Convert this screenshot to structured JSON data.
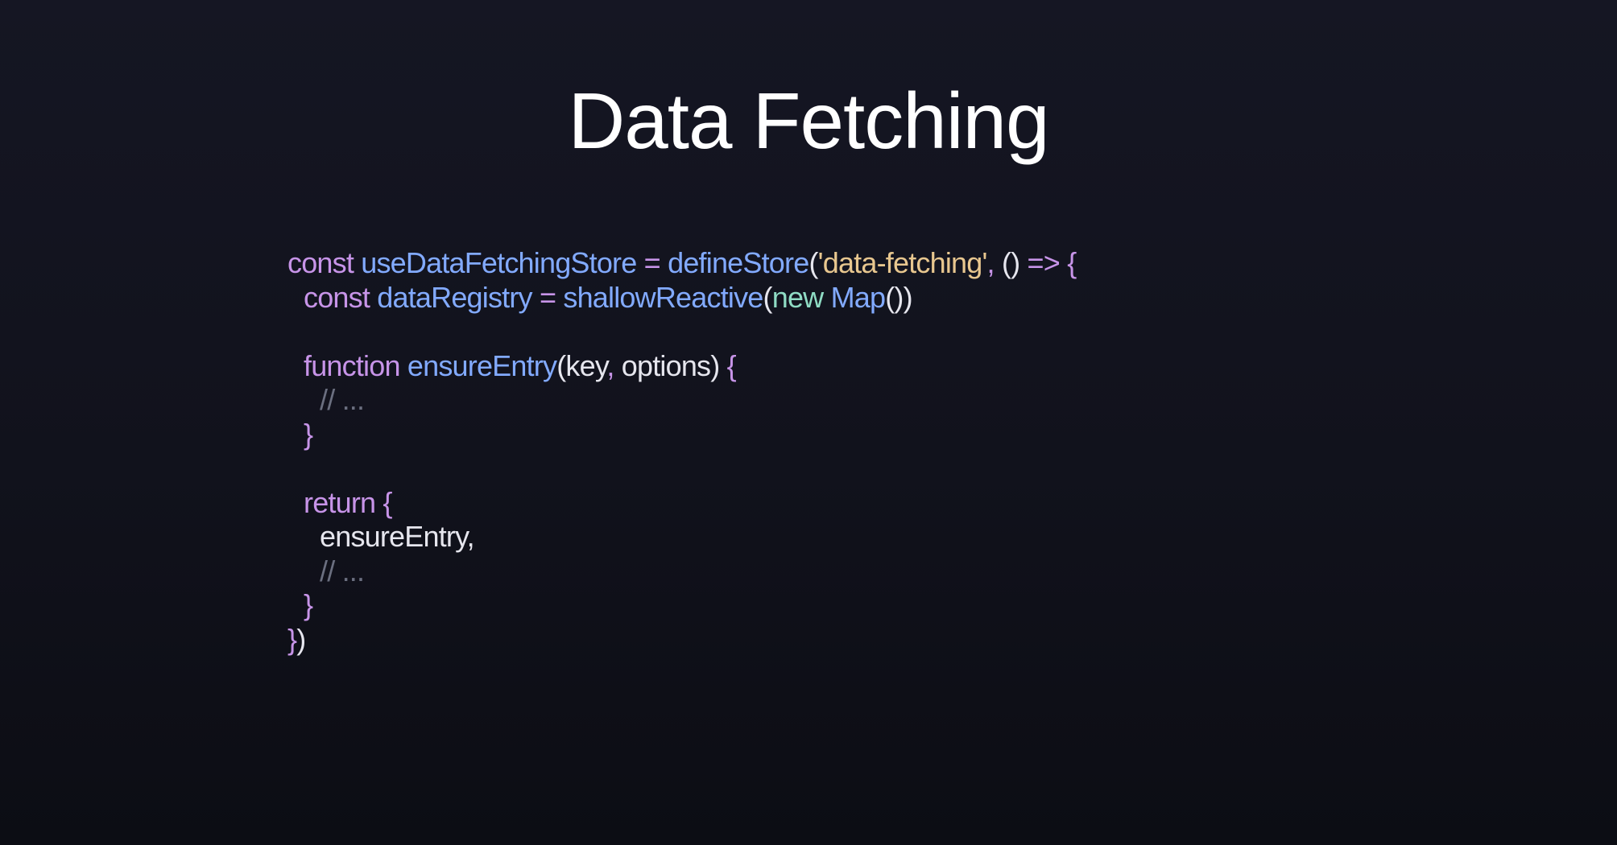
{
  "slide": {
    "title": "Data Fetching"
  },
  "colors": {
    "keyword": "#c794e8",
    "function": "#82aaff",
    "string": "#e8c78f",
    "constructor_keyword": "#8fdcc4",
    "plain": "#e6e6ee",
    "comment": "#6b6f80",
    "background": "#13141f"
  },
  "code": {
    "language": "javascript",
    "lines": [
      {
        "indent": 0,
        "tokens": [
          {
            "text": "const ",
            "kind": "keyword"
          },
          {
            "text": "useDataFetchingStore",
            "kind": "function"
          },
          {
            "text": " = ",
            "kind": "keyword"
          },
          {
            "text": "defineStore",
            "kind": "function"
          },
          {
            "text": "(",
            "kind": "plain"
          },
          {
            "text": "'data-fetching'",
            "kind": "string"
          },
          {
            "text": ", ",
            "kind": "keyword"
          },
          {
            "text": "() ",
            "kind": "plain"
          },
          {
            "text": "=> {",
            "kind": "keyword"
          }
        ]
      },
      {
        "indent": 1,
        "tokens": [
          {
            "text": "const ",
            "kind": "keyword"
          },
          {
            "text": "dataRegistry",
            "kind": "function"
          },
          {
            "text": " = ",
            "kind": "keyword"
          },
          {
            "text": "shallowReactive",
            "kind": "function"
          },
          {
            "text": "(",
            "kind": "plain"
          },
          {
            "text": "new ",
            "kind": "constructor_keyword"
          },
          {
            "text": "Map",
            "kind": "function"
          },
          {
            "text": "())",
            "kind": "plain"
          }
        ]
      },
      {
        "indent": 0,
        "tokens": []
      },
      {
        "indent": 1,
        "tokens": [
          {
            "text": "function ",
            "kind": "keyword"
          },
          {
            "text": "ensureEntry",
            "kind": "function"
          },
          {
            "text": "(key",
            "kind": "plain"
          },
          {
            "text": ", ",
            "kind": "keyword"
          },
          {
            "text": "options) ",
            "kind": "plain"
          },
          {
            "text": "{",
            "kind": "keyword"
          }
        ]
      },
      {
        "indent": 2,
        "tokens": [
          {
            "text": "// ...",
            "kind": "comment"
          }
        ]
      },
      {
        "indent": 1,
        "tokens": [
          {
            "text": "}",
            "kind": "keyword"
          }
        ]
      },
      {
        "indent": 0,
        "tokens": []
      },
      {
        "indent": 1,
        "tokens": [
          {
            "text": "return ",
            "kind": "keyword"
          },
          {
            "text": "{",
            "kind": "keyword"
          }
        ]
      },
      {
        "indent": 2,
        "tokens": [
          {
            "text": "ensureEntry,",
            "kind": "plain"
          }
        ]
      },
      {
        "indent": 2,
        "tokens": [
          {
            "text": "// ...",
            "kind": "comment"
          }
        ]
      },
      {
        "indent": 1,
        "tokens": [
          {
            "text": "}",
            "kind": "keyword"
          }
        ]
      },
      {
        "indent": 0,
        "tokens": [
          {
            "text": "}",
            "kind": "keyword"
          },
          {
            "text": ")",
            "kind": "plain"
          }
        ]
      }
    ]
  }
}
